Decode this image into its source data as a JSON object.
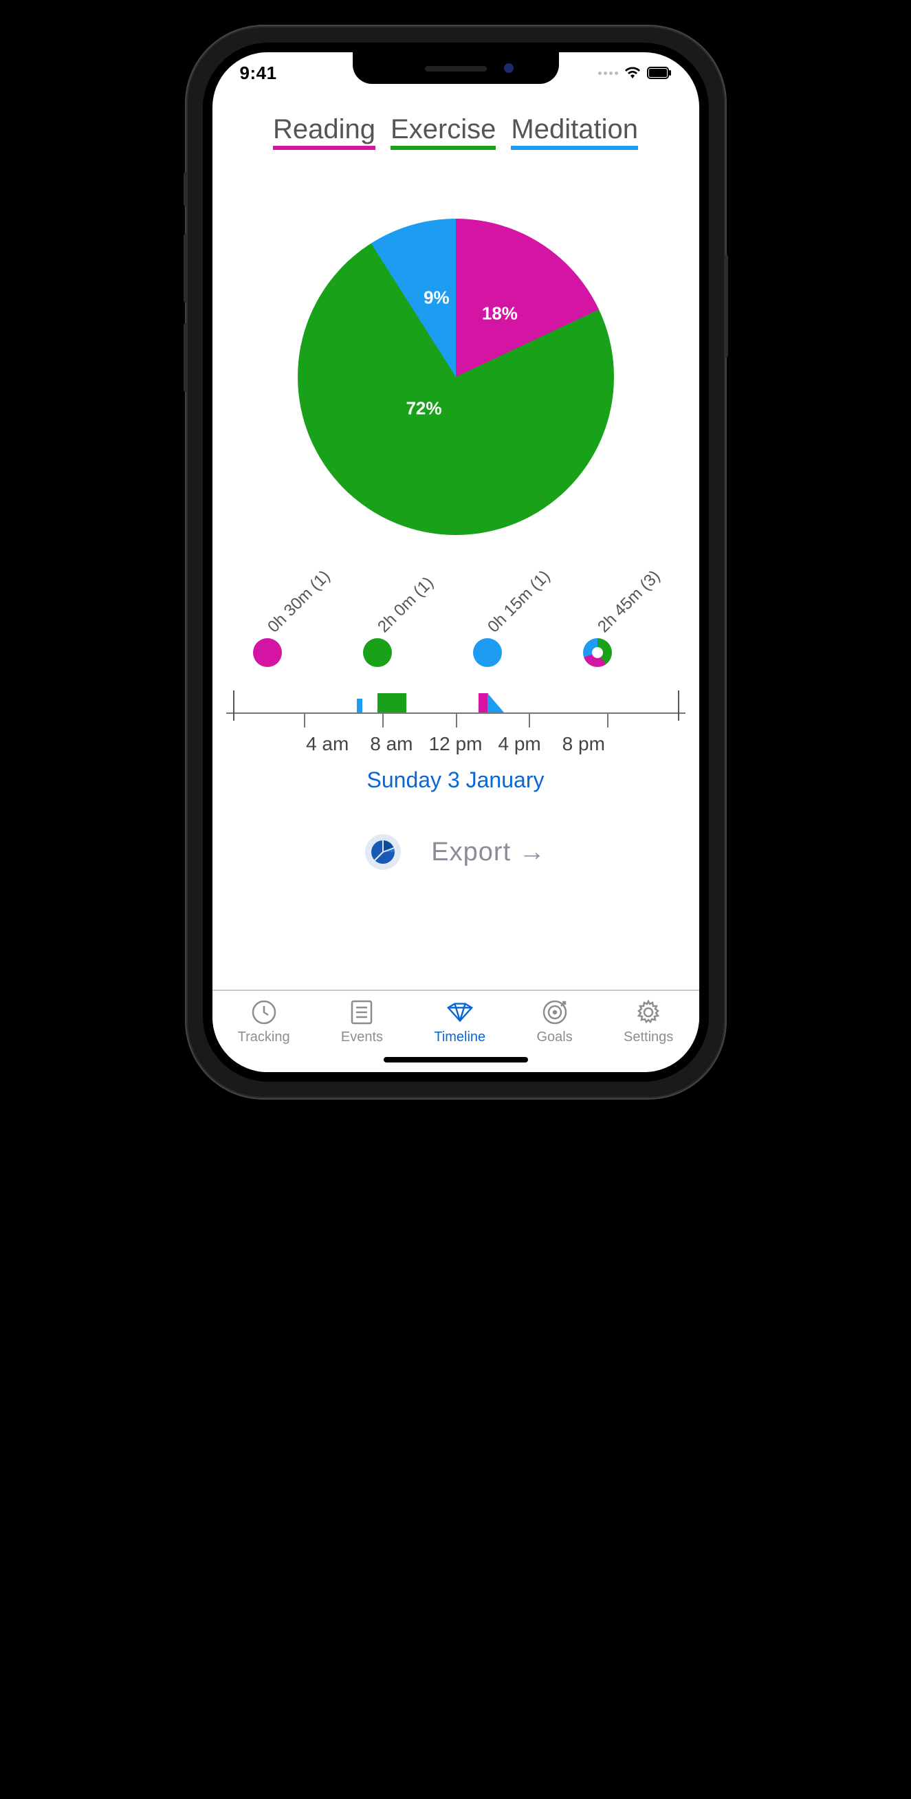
{
  "status": {
    "time": "9:41"
  },
  "colors": {
    "reading": "#d414a3",
    "exercise": "#19a219",
    "meditation": "#1d9df2",
    "accent": "#0a66d6",
    "grey": "#8d8d8d"
  },
  "legend": {
    "items": [
      {
        "label": "Reading",
        "color": "#d414a3"
      },
      {
        "label": "Exercise",
        "color": "#19a219"
      },
      {
        "label": "Meditation",
        "color": "#1d9df2"
      }
    ]
  },
  "chart_data": {
    "type": "pie",
    "title": "",
    "series": [
      {
        "name": "Exercise",
        "value": 72,
        "color": "#19a219"
      },
      {
        "name": "Reading",
        "value": 18,
        "color": "#d414a3"
      },
      {
        "name": "Meditation",
        "value": 9,
        "color": "#1d9df2"
      }
    ]
  },
  "pie_labels": {
    "reading": "18%",
    "exercise": "72%",
    "meditation": "9%"
  },
  "chips": [
    {
      "label": "0h 30m (1)",
      "color": "#d414a3"
    },
    {
      "label": "2h 0m (1)",
      "color": "#19a219"
    },
    {
      "label": "0h 15m (1)",
      "color": "#1d9df2"
    },
    {
      "label": "2h 45m (3)",
      "color": "multi"
    }
  ],
  "timeline": {
    "ticks": [
      "4 am",
      "8 am",
      "12 pm",
      "4 pm",
      "8 pm"
    ],
    "date": "Sunday 3 January"
  },
  "export": {
    "label": "Export →"
  },
  "tabs": [
    {
      "label": "Tracking"
    },
    {
      "label": "Events"
    },
    {
      "label": "Timeline"
    },
    {
      "label": "Goals"
    },
    {
      "label": "Settings"
    }
  ]
}
